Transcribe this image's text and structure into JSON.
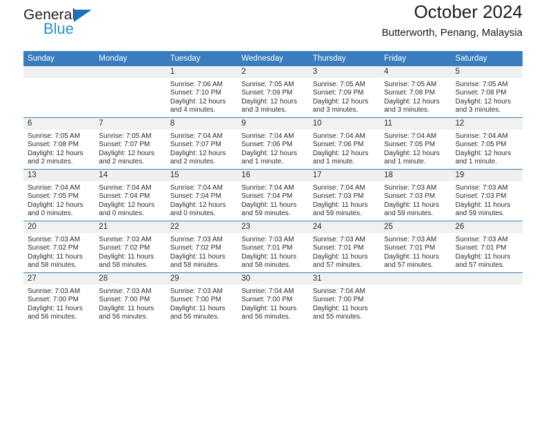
{
  "brand": {
    "name_top": "General",
    "name_bottom": "Blue",
    "triangle_color": "#1c72b8",
    "text_color": "#231f20",
    "blue_color": "#2a90d4"
  },
  "header": {
    "title": "October 2024",
    "subtitle": "Butterworth, Penang, Malaysia"
  },
  "theme": {
    "header_bg": "#3a7dbe",
    "header_text": "#ffffff",
    "daynum_bg": "#f0f0f0",
    "row_rule": "#3a7dbe",
    "body_text": "#2b2b2b"
  },
  "weekday_headers": [
    "Sunday",
    "Monday",
    "Tuesday",
    "Wednesday",
    "Thursday",
    "Friday",
    "Saturday"
  ],
  "weeks": [
    [
      {
        "day": "",
        "lines": []
      },
      {
        "day": "",
        "lines": []
      },
      {
        "day": "1",
        "lines": [
          "Sunrise: 7:06 AM",
          "Sunset: 7:10 PM",
          "Daylight: 12 hours",
          "and 4 minutes."
        ]
      },
      {
        "day": "2",
        "lines": [
          "Sunrise: 7:05 AM",
          "Sunset: 7:09 PM",
          "Daylight: 12 hours",
          "and 3 minutes."
        ]
      },
      {
        "day": "3",
        "lines": [
          "Sunrise: 7:05 AM",
          "Sunset: 7:09 PM",
          "Daylight: 12 hours",
          "and 3 minutes."
        ]
      },
      {
        "day": "4",
        "lines": [
          "Sunrise: 7:05 AM",
          "Sunset: 7:08 PM",
          "Daylight: 12 hours",
          "and 3 minutes."
        ]
      },
      {
        "day": "5",
        "lines": [
          "Sunrise: 7:05 AM",
          "Sunset: 7:08 PM",
          "Daylight: 12 hours",
          "and 3 minutes."
        ]
      }
    ],
    [
      {
        "day": "6",
        "lines": [
          "Sunrise: 7:05 AM",
          "Sunset: 7:08 PM",
          "Daylight: 12 hours",
          "and 2 minutes."
        ]
      },
      {
        "day": "7",
        "lines": [
          "Sunrise: 7:05 AM",
          "Sunset: 7:07 PM",
          "Daylight: 12 hours",
          "and 2 minutes."
        ]
      },
      {
        "day": "8",
        "lines": [
          "Sunrise: 7:04 AM",
          "Sunset: 7:07 PM",
          "Daylight: 12 hours",
          "and 2 minutes."
        ]
      },
      {
        "day": "9",
        "lines": [
          "Sunrise: 7:04 AM",
          "Sunset: 7:06 PM",
          "Daylight: 12 hours",
          "and 1 minute."
        ]
      },
      {
        "day": "10",
        "lines": [
          "Sunrise: 7:04 AM",
          "Sunset: 7:06 PM",
          "Daylight: 12 hours",
          "and 1 minute."
        ]
      },
      {
        "day": "11",
        "lines": [
          "Sunrise: 7:04 AM",
          "Sunset: 7:05 PM",
          "Daylight: 12 hours",
          "and 1 minute."
        ]
      },
      {
        "day": "12",
        "lines": [
          "Sunrise: 7:04 AM",
          "Sunset: 7:05 PM",
          "Daylight: 12 hours",
          "and 1 minute."
        ]
      }
    ],
    [
      {
        "day": "13",
        "lines": [
          "Sunrise: 7:04 AM",
          "Sunset: 7:05 PM",
          "Daylight: 12 hours",
          "and 0 minutes."
        ]
      },
      {
        "day": "14",
        "lines": [
          "Sunrise: 7:04 AM",
          "Sunset: 7:04 PM",
          "Daylight: 12 hours",
          "and 0 minutes."
        ]
      },
      {
        "day": "15",
        "lines": [
          "Sunrise: 7:04 AM",
          "Sunset: 7:04 PM",
          "Daylight: 12 hours",
          "and 0 minutes."
        ]
      },
      {
        "day": "16",
        "lines": [
          "Sunrise: 7:04 AM",
          "Sunset: 7:04 PM",
          "Daylight: 11 hours",
          "and 59 minutes."
        ]
      },
      {
        "day": "17",
        "lines": [
          "Sunrise: 7:04 AM",
          "Sunset: 7:03 PM",
          "Daylight: 11 hours",
          "and 59 minutes."
        ]
      },
      {
        "day": "18",
        "lines": [
          "Sunrise: 7:03 AM",
          "Sunset: 7:03 PM",
          "Daylight: 11 hours",
          "and 59 minutes."
        ]
      },
      {
        "day": "19",
        "lines": [
          "Sunrise: 7:03 AM",
          "Sunset: 7:03 PM",
          "Daylight: 11 hours",
          "and 59 minutes."
        ]
      }
    ],
    [
      {
        "day": "20",
        "lines": [
          "Sunrise: 7:03 AM",
          "Sunset: 7:02 PM",
          "Daylight: 11 hours",
          "and 58 minutes."
        ]
      },
      {
        "day": "21",
        "lines": [
          "Sunrise: 7:03 AM",
          "Sunset: 7:02 PM",
          "Daylight: 11 hours",
          "and 58 minutes."
        ]
      },
      {
        "day": "22",
        "lines": [
          "Sunrise: 7:03 AM",
          "Sunset: 7:02 PM",
          "Daylight: 11 hours",
          "and 58 minutes."
        ]
      },
      {
        "day": "23",
        "lines": [
          "Sunrise: 7:03 AM",
          "Sunset: 7:01 PM",
          "Daylight: 11 hours",
          "and 58 minutes."
        ]
      },
      {
        "day": "24",
        "lines": [
          "Sunrise: 7:03 AM",
          "Sunset: 7:01 PM",
          "Daylight: 11 hours",
          "and 57 minutes."
        ]
      },
      {
        "day": "25",
        "lines": [
          "Sunrise: 7:03 AM",
          "Sunset: 7:01 PM",
          "Daylight: 11 hours",
          "and 57 minutes."
        ]
      },
      {
        "day": "26",
        "lines": [
          "Sunrise: 7:03 AM",
          "Sunset: 7:01 PM",
          "Daylight: 11 hours",
          "and 57 minutes."
        ]
      }
    ],
    [
      {
        "day": "27",
        "lines": [
          "Sunrise: 7:03 AM",
          "Sunset: 7:00 PM",
          "Daylight: 11 hours",
          "and 56 minutes."
        ]
      },
      {
        "day": "28",
        "lines": [
          "Sunrise: 7:03 AM",
          "Sunset: 7:00 PM",
          "Daylight: 11 hours",
          "and 56 minutes."
        ]
      },
      {
        "day": "29",
        "lines": [
          "Sunrise: 7:03 AM",
          "Sunset: 7:00 PM",
          "Daylight: 11 hours",
          "and 56 minutes."
        ]
      },
      {
        "day": "30",
        "lines": [
          "Sunrise: 7:04 AM",
          "Sunset: 7:00 PM",
          "Daylight: 11 hours",
          "and 56 minutes."
        ]
      },
      {
        "day": "31",
        "lines": [
          "Sunrise: 7:04 AM",
          "Sunset: 7:00 PM",
          "Daylight: 11 hours",
          "and 55 minutes."
        ]
      },
      {
        "day": "",
        "lines": []
      },
      {
        "day": "",
        "lines": []
      }
    ]
  ]
}
